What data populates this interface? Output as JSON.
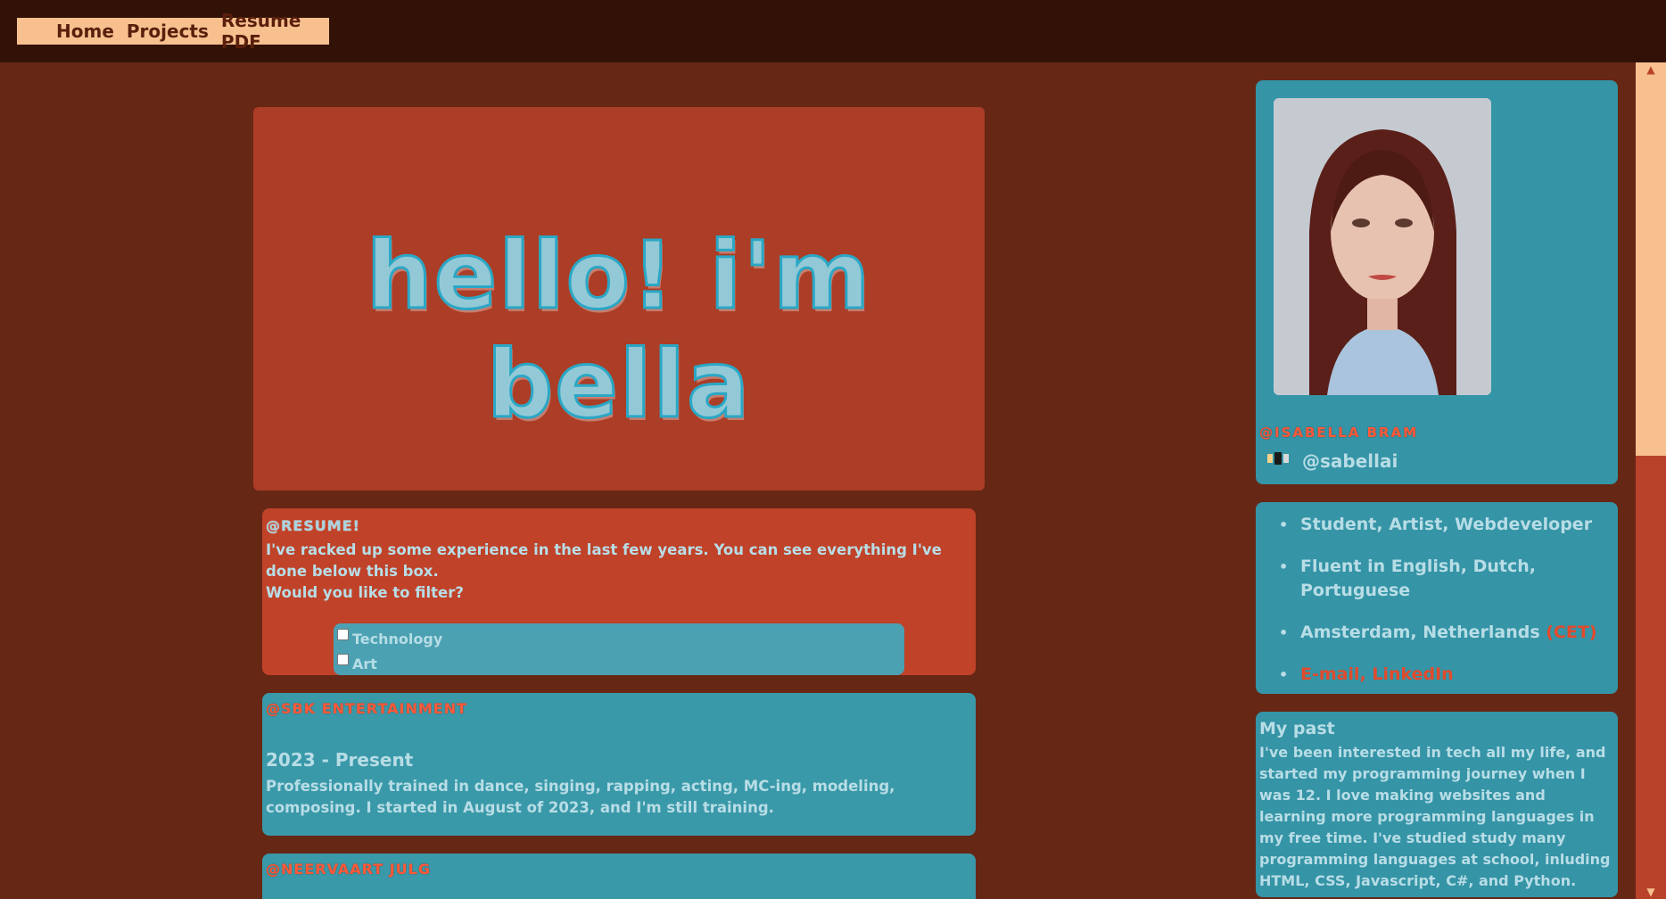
{
  "nav": {
    "items": [
      {
        "label": "Home"
      },
      {
        "label": "Projects"
      },
      {
        "label": "Resume PDF"
      }
    ]
  },
  "hero": {
    "title": "hello! i'm bella"
  },
  "resume": {
    "heading": "@RESUME!",
    "text_line1": "I've racked up some experience in the last few years. You can see everything I've done below this box.",
    "text_line2": "Would you like to filter?",
    "filters": [
      {
        "label": "Technology",
        "checked": false
      },
      {
        "label": "Art",
        "checked": false
      }
    ]
  },
  "experience": [
    {
      "heading": "@SBK ENTERTAINMENT",
      "date": "2023 - Present",
      "description": "Professionally trained in dance, singing, rapping, acting, MC-ing, modeling, composing. I started in August of 2023, and I'm still training."
    },
    {
      "heading": "@NEERVAART JULG",
      "date": "",
      "description": ""
    }
  ],
  "profile": {
    "name_tag": "@ISABELLA BRAM",
    "handle_icon": "gif-icon",
    "handle": "@sabellai",
    "bullets": [
      {
        "text": "Student, Artist, Webdeveloper",
        "accent": ""
      },
      {
        "text": "Fluent in English, Dutch, Portuguese",
        "accent": ""
      },
      {
        "text": "Amsterdam, Netherlands ",
        "accent": "(CET)"
      },
      {
        "text": "",
        "accent": "E-mail, LinkedIn"
      }
    ]
  },
  "past": {
    "title": "My past",
    "text": "I've been interested in tech all my life, and started my programming journey when I was 12. I love making websites and learning more programming languages in my free time. I've studied study many programming languages at school, inluding HTML, CSS, Javascript, C#, and Python."
  },
  "colors": {
    "background": "#672715",
    "topbar": "#321207",
    "nav_bg": "#f8c08f",
    "hero_bg": "#ac3d26",
    "card_teal": "#3594a6",
    "accent_orange": "#e24a2c",
    "text_light": "#b8dde6"
  }
}
